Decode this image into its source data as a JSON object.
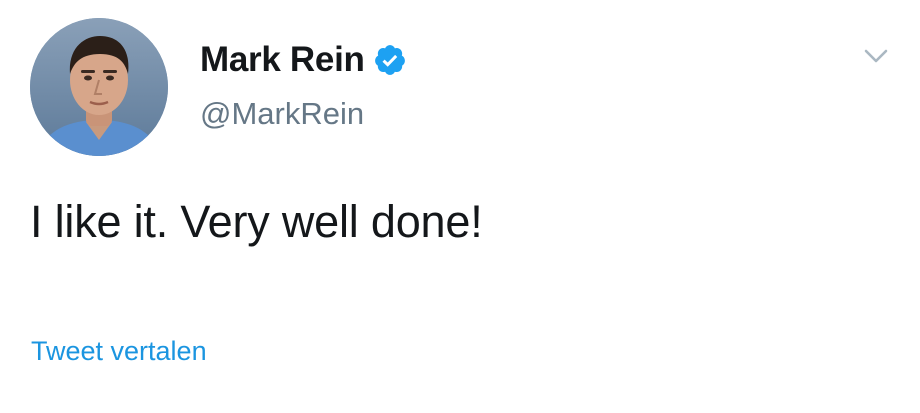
{
  "tweet": {
    "author": {
      "display_name": "Mark Rein",
      "handle": "@MarkRein",
      "verified": true,
      "verified_icon": "verified-badge-icon",
      "avatar_icon": "profile-photo"
    },
    "text": "I like it. Very well done!",
    "translate_label": "Tweet vertalen",
    "menu_icon": "chevron-down-icon"
  },
  "colors": {
    "name": "#14171a",
    "handle": "#657786",
    "link": "#1b95e0",
    "verified": "#1da1f2",
    "chevron": "#aab8c2"
  }
}
